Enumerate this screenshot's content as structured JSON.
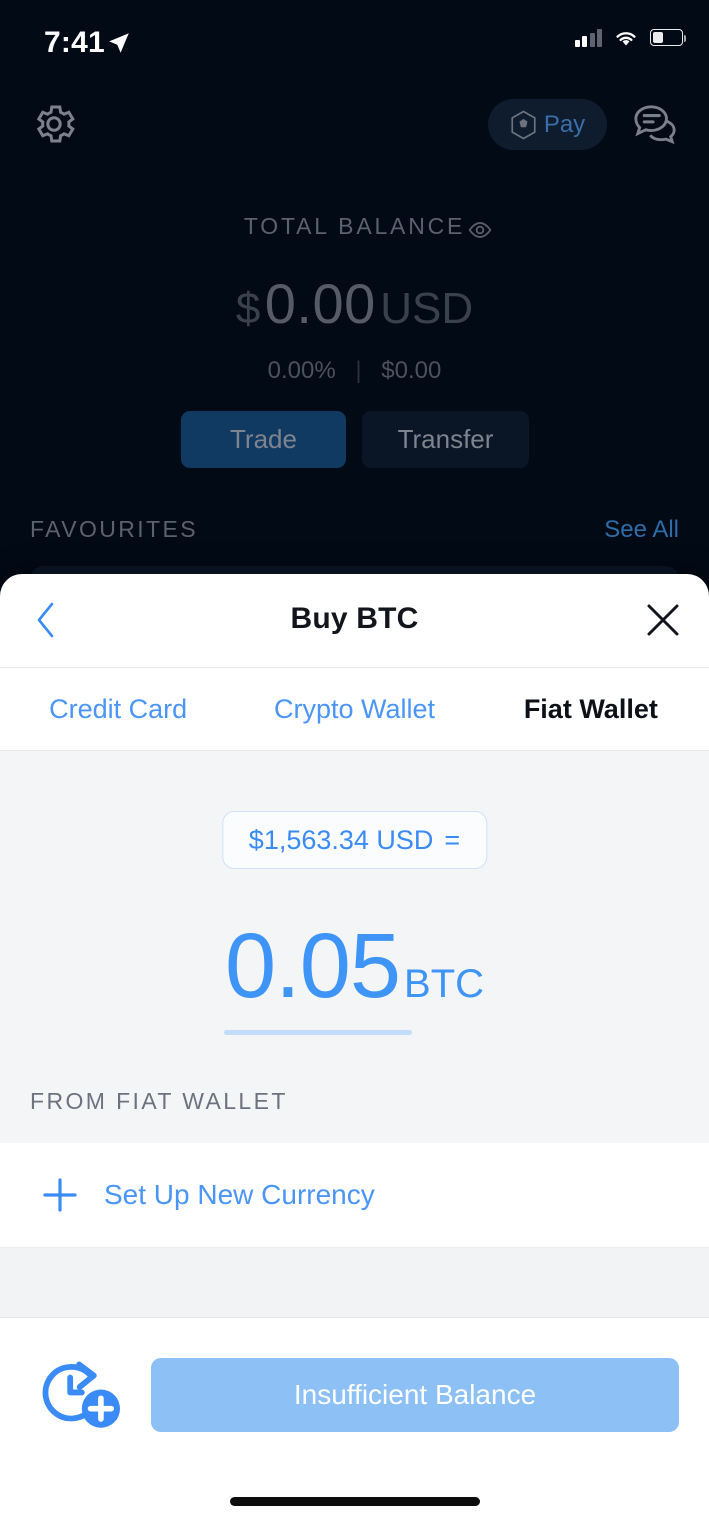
{
  "status_bar": {
    "time": "7:41",
    "location_icon": "location-arrow-icon",
    "signal_icon": "cellular-signal-icon",
    "wifi_icon": "wifi-icon",
    "battery_icon": "battery-icon"
  },
  "top_nav": {
    "settings_icon": "gear-icon",
    "pay_label": "Pay",
    "pay_icon": "crypto-com-logo-icon",
    "chat_icon": "chat-bubbles-icon"
  },
  "balance": {
    "label": "TOTAL BALANCE",
    "eye_icon": "eye-icon",
    "currency_symbol": "$",
    "amount": "0.00",
    "currency_code": "USD",
    "change_percent": "0.00%",
    "change_value": "$0.00",
    "separator": "|"
  },
  "actions": {
    "trade_label": "Trade",
    "transfer_label": "Transfer"
  },
  "favourites": {
    "title": "FAVOURITES",
    "see_all_label": "See All"
  },
  "sheet": {
    "title": "Buy BTC",
    "back_icon": "chevron-left-icon",
    "close_icon": "close-x-icon",
    "tabs": [
      {
        "label": "Credit Card",
        "active": false
      },
      {
        "label": "Crypto Wallet",
        "active": false
      },
      {
        "label": "Fiat Wallet",
        "active": true
      }
    ],
    "amount": {
      "fiat_pill": "$1,563.34 USD",
      "equals_symbol": "=",
      "crypto_value": "0.05",
      "crypto_unit": "BTC"
    },
    "from_label": "FROM FIAT WALLET",
    "setup_row": {
      "plus_icon": "plus-icon",
      "label": "Set Up New Currency"
    },
    "bottom": {
      "recurring_icon": "recurring-buy-clock-plus-icon",
      "cta_label": "Insufficient Balance"
    }
  },
  "colors": {
    "app_bg": "#020a16",
    "accent_blue": "#4a95f7",
    "cta_blue": "#8dc0f5",
    "sheet_bg": "#ffffff",
    "amount_area_bg": "#f4f5f7",
    "trade_bg": "#113a63",
    "transfer_bg": "#0a1626"
  }
}
